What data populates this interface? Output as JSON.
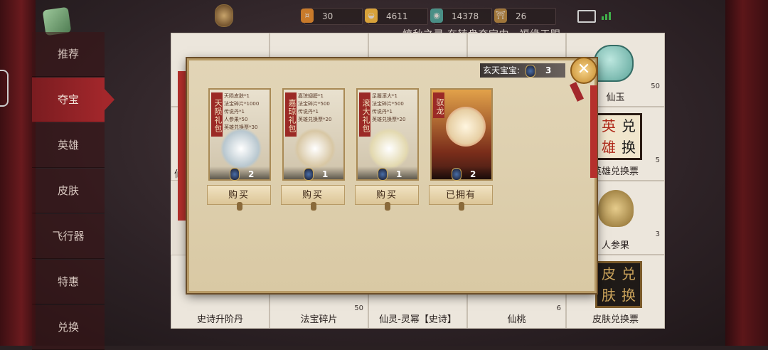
{
  "topbar": {
    "resources": [
      {
        "icon": "coin-icon",
        "value": "30"
      },
      {
        "icon": "gold-ingot-icon",
        "value": "4611"
      },
      {
        "icon": "jade-icon",
        "value": "14378"
      },
      {
        "icon": "gate-icon",
        "value": "26"
      }
    ]
  },
  "marquee": "惊秋之灵 在转盘夺宝中，福缘天赐",
  "nav": {
    "items": [
      "推荐",
      "夺宝",
      "英雄",
      "皮肤",
      "飞行器",
      "特惠",
      "兑换"
    ],
    "active_index": 1
  },
  "shop_grid": {
    "cells": [
      {
        "label": "",
        "count": ""
      },
      {
        "label": "",
        "count": ""
      },
      {
        "label": "",
        "count": ""
      },
      {
        "label": "",
        "count": ""
      },
      {
        "label": "仙玉",
        "count": "50"
      },
      {
        "label": "仙",
        "count": ""
      },
      {
        "label": "",
        "count": ""
      },
      {
        "label": "",
        "count": ""
      },
      {
        "label": "",
        "count": ""
      },
      {
        "label": "英雄兑换票",
        "count": "5"
      },
      {
        "label": "",
        "count": ""
      },
      {
        "label": "",
        "count": ""
      },
      {
        "label": "",
        "count": ""
      },
      {
        "label": "",
        "count": ""
      },
      {
        "label": "人参果",
        "count": "3"
      },
      {
        "label": "史诗升阶丹",
        "count": ""
      },
      {
        "label": "法宝碎片",
        "count": "50"
      },
      {
        "label": "仙灵-灵幂【史诗】",
        "count": ""
      },
      {
        "label": "仙桃",
        "count": "6"
      },
      {
        "label": "皮肤兑换票",
        "count": ""
      }
    ],
    "exchange_hero_chars": [
      "英",
      "兑",
      "雄",
      "换"
    ],
    "exchange_skin_chars": [
      "皮",
      "兑",
      "肤",
      "换"
    ]
  },
  "dialog": {
    "counter_label": "玄天宝宝:",
    "counter_value": "3",
    "close_label": "✕",
    "cards": [
      {
        "title": "天陨礼包",
        "lines": [
          "天陨皮肤*1",
          "法宝碎片*1000",
          "传说丹*1",
          "人参果*50",
          "英雄兑换票*30"
        ],
        "qty": "2",
        "button": "购买"
      },
      {
        "title": "嘉琼礼包",
        "lines": [
          "嘉琼翅膀*1",
          "法宝碎片*500",
          "传说丹*1",
          "英雄兑换票*20"
        ],
        "qty": "1",
        "button": "购买"
      },
      {
        "title": "滚大礼包",
        "lines": [
          "足履滚大*1",
          "法宝碎片*500",
          "传说丹*1",
          "英雄兑换票*20"
        ],
        "qty": "1",
        "button": "购买"
      },
      {
        "title": "驭龙",
        "lines": [],
        "qty": "2",
        "button": "已拥有"
      }
    ]
  },
  "colors": {
    "nav_active": "#a3272b",
    "dialog_bg": "#e2d5b7",
    "title_red": "#9b2a26"
  }
}
